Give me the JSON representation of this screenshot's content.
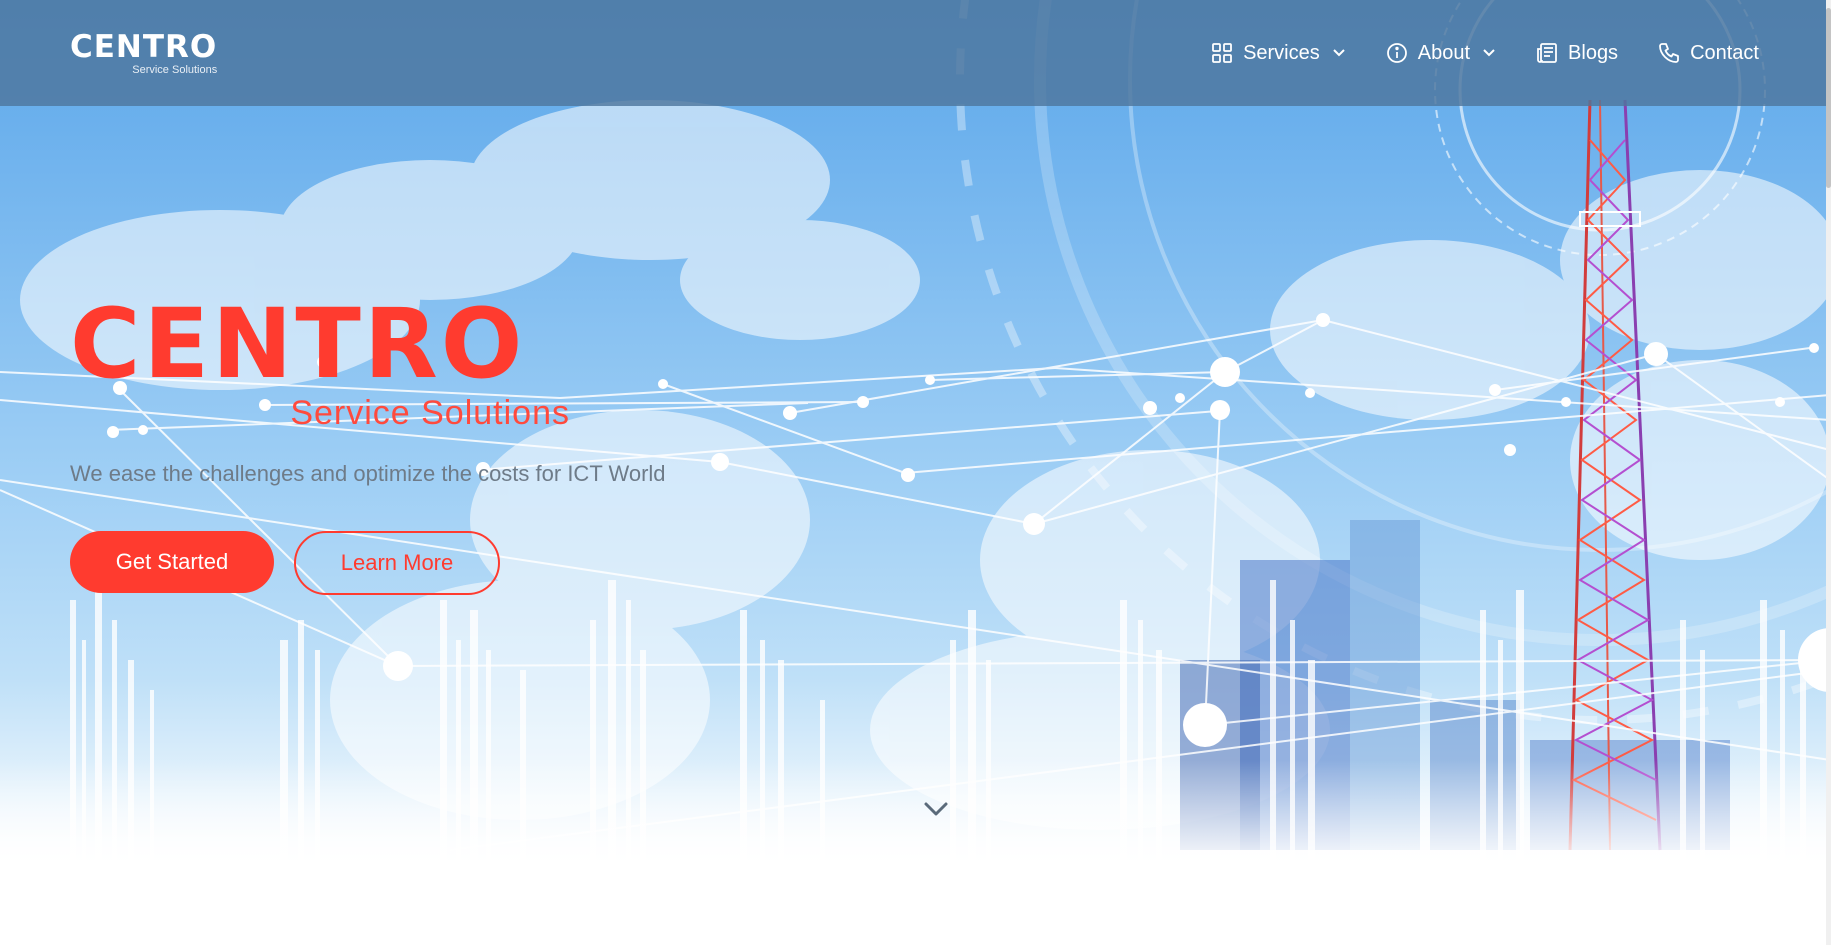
{
  "brand": {
    "name": "CENTRO",
    "tagline": "Service Solutions"
  },
  "nav": {
    "items": [
      {
        "label": "Services",
        "icon": "grid-icon",
        "dropdown": true
      },
      {
        "label": "About",
        "icon": "info-icon",
        "dropdown": true
      },
      {
        "label": "Blogs",
        "icon": "newspaper-icon",
        "dropdown": false
      },
      {
        "label": "Contact",
        "icon": "phone-icon",
        "dropdown": false
      }
    ]
  },
  "hero": {
    "title": "CENTRO",
    "subtitle": "Service Solutions",
    "description": "We ease the challenges and optimize the costs for ICT World",
    "primary_button": "Get Started",
    "secondary_button": "Learn More",
    "scroll_icon": "chevron-down-icon"
  },
  "colors": {
    "accent": "#ff3b2f",
    "nav_bg": "#4e769e",
    "sky": "#7fbcf0",
    "text_muted": "#6e7b88"
  }
}
